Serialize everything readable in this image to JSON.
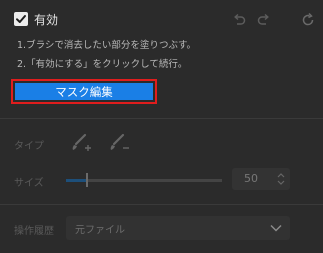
{
  "header": {
    "enable_label": "有効",
    "enabled": true,
    "icons": [
      "checkbox-check-icon",
      "undo-icon",
      "redo-icon",
      "reset-icon"
    ]
  },
  "instructions": {
    "line1": "1.ブラシで消去したい部分を塗りつぶす。",
    "line2": "2.「有効にする」をクリックして続行。"
  },
  "mask_button": {
    "label": "マスク編集"
  },
  "type_row": {
    "label": "タイプ",
    "icons": [
      "brush-add-icon",
      "brush-subtract-icon"
    ]
  },
  "size_row": {
    "label": "サイズ",
    "value": "50",
    "slider_fraction": 0.13
  },
  "layer_row": {
    "label": "操作履歴",
    "selected": "元ファイル"
  },
  "colors": {
    "background": "#2b2b2b",
    "accent": "#1a7fe6",
    "highlight_border": "#e01d1d"
  }
}
